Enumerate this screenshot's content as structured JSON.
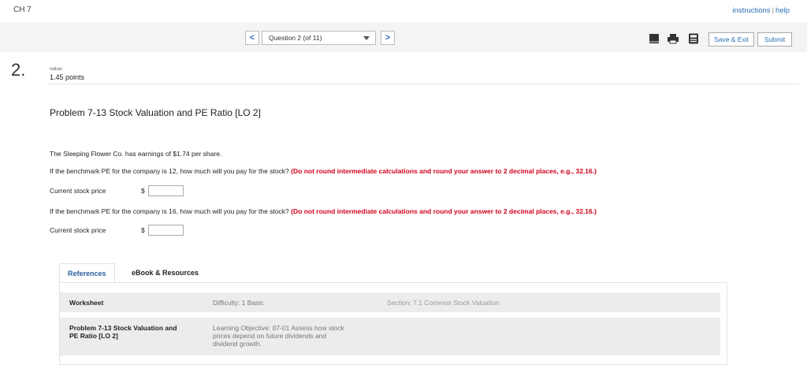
{
  "header": {
    "chapter": "CH 7",
    "instructions": "instructions",
    "separator": "|",
    "help": "help"
  },
  "toolbar": {
    "prev_label": "<",
    "question_selector": "Question 2 (of 11)",
    "next_label": ">",
    "save_exit_label": "Save & Exit",
    "submit_label": "Submit",
    "icons": [
      "book-icon",
      "printer-icon",
      "calculator-icon"
    ]
  },
  "question": {
    "number": "2.",
    "value_label": "value:",
    "points": "1.45 points",
    "title": "Problem 7-13 Stock Valuation and PE Ratio [LO 2]",
    "intro": "The Sleeping Flower Co. has earnings of $1.74 per share.",
    "part1_text": "If the benchmark PE for the company is 12, how much will you pay for the stock?",
    "part1_note": "(Do not round intermediate calculations and round your answer to 2 decimal places, e.g., 32.16.)",
    "part1_label": "Current stock price",
    "part1_currency": "$",
    "part1_value": "",
    "part2_text": "If the benchmark PE for the company is 16, how much will you pay for the stock?",
    "part2_note": "(Do not round intermediate calculations and round your answer to 2 decimal places, e.g., 32.16.)",
    "part2_label": "Current stock price",
    "part2_currency": "$",
    "part2_value": ""
  },
  "references": {
    "tabs": [
      "References",
      "eBook & Resources"
    ],
    "row1": {
      "name": "Worksheet",
      "difficulty": "Difficulty: 1 Basic",
      "section": "Section: 7.1 Common Stock Valuation"
    },
    "row2": {
      "name_line1": "Problem 7-13 Stock Valuation and",
      "name_line2": "PE Ratio [LO 2]",
      "objective_line1": "Learning Objective: 07-01 Assess how stock",
      "objective_line2": "prices depend on future dividends and",
      "objective_line3": "dividend growth."
    }
  },
  "colors": {
    "accent": "#2a6fb5",
    "note_red": "#d0021b",
    "toolbar_bg": "#f4f4f4"
  }
}
